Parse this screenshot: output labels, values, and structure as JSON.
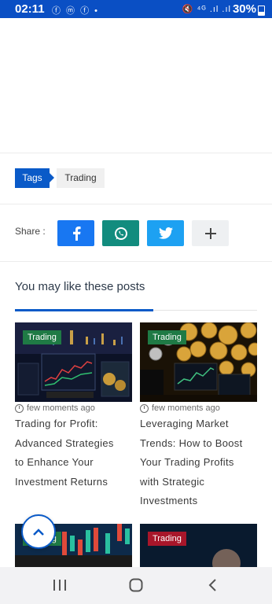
{
  "status_bar": {
    "time": "02:11",
    "left_icons": "ⓕ ⓜ ⓕ •",
    "right_icons": "🔇 ⁴ᴳ .ıl .ıl",
    "battery": "30%"
  },
  "tags": {
    "label": "Tags",
    "items": [
      "Trading"
    ]
  },
  "share": {
    "label": "Share :",
    "buttons": [
      {
        "name": "facebook",
        "icon": "facebook-icon"
      },
      {
        "name": "whatsapp",
        "icon": "whatsapp-icon"
      },
      {
        "name": "twitter",
        "icon": "twitter-icon"
      },
      {
        "name": "more",
        "icon": "plus-icon"
      }
    ]
  },
  "related": {
    "title": "You may like these posts",
    "posts": [
      {
        "category": "Trading",
        "time": "few moments ago",
        "title_lines": [
          "Trading for Profit:",
          "Advanced Strategies",
          "to Enhance Your",
          "Investment Returns"
        ]
      },
      {
        "category": "Trading",
        "time": "few moments ago",
        "title_lines": [
          "Leveraging Market",
          "Trends: How to Boost",
          "Your Trading Profits",
          "with Strategic",
          "Investments"
        ]
      },
      {
        "category": "Trading",
        "time": "",
        "title_lines": []
      },
      {
        "category": "Trading",
        "time": "",
        "title_lines": []
      }
    ]
  },
  "colors": {
    "accent": "#0a5ac8",
    "badge_green": "#1f7a45",
    "badge_red": "#a8162a"
  }
}
